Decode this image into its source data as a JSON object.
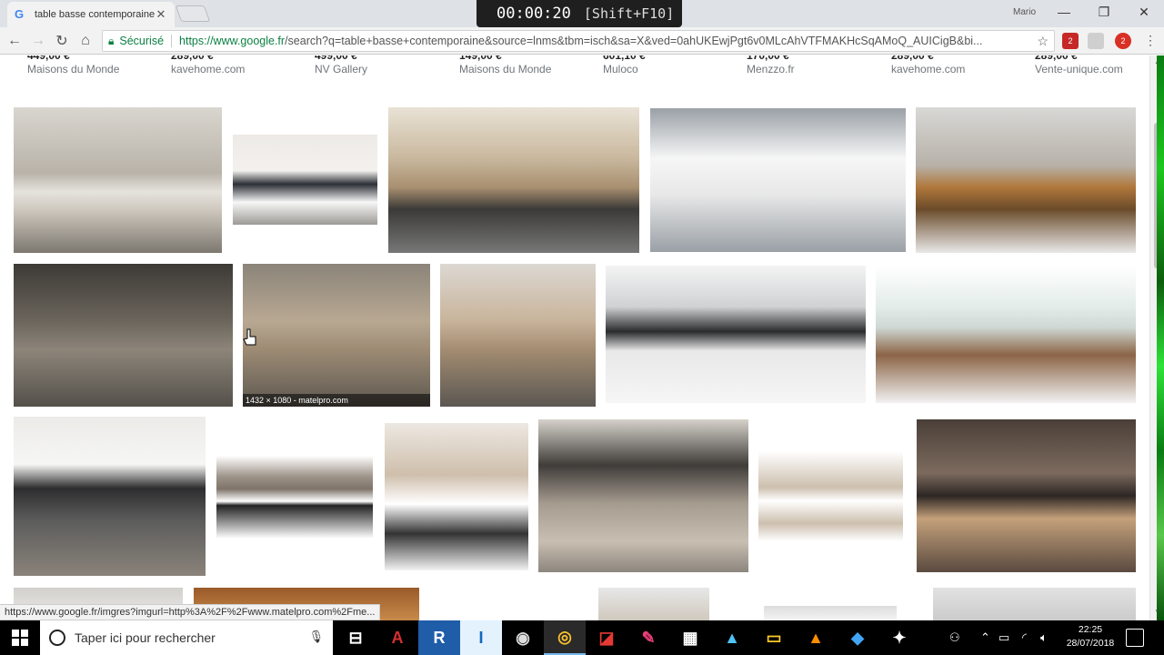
{
  "browser": {
    "tab_title": "table basse contemporaine",
    "tab_favicon": "G",
    "user_name": "Mario",
    "recorder": {
      "time": "00:00:20",
      "hotkey": "[Shift+F10]"
    },
    "security_label": "Sécurisé",
    "url_host": "https://www.google.fr",
    "url_rest": "/search?q=table+basse+contemporaine&source=lnms&tbm=isch&sa=X&ved=0ahUKEwjPgt6v0MLcAhVTFMAKHcSqAMoQ_AUICigB&bi...",
    "ext_badges": [
      "2",
      "2"
    ]
  },
  "shopping_strip": [
    {
      "price": "449,00 €",
      "store": "Maisons du Monde"
    },
    {
      "price": "289,00 €",
      "store": "kavehome.com"
    },
    {
      "price": "499,00 €",
      "store": "NV Gallery"
    },
    {
      "price": "149,00 €",
      "store": "Maisons du Monde"
    },
    {
      "price": "601,10 €",
      "store": "Muloco"
    },
    {
      "price": "170,00 €",
      "store": "Menzzo.fr"
    },
    {
      "price": "289,00 €",
      "store": "kavehome.com"
    },
    {
      "price": "289,00 €",
      "store": "Vente-unique.com"
    }
  ],
  "results": [
    {
      "id": "r1",
      "desc": "grey living room coffee table with drawers"
    },
    {
      "id": "r2",
      "desc": "black and white modern coffee table"
    },
    {
      "id": "r3",
      "desc": "wooden table with trestle legs on striped rug"
    },
    {
      "id": "r4",
      "desc": "white square lacquered coffee table"
    },
    {
      "id": "r5",
      "desc": "wood frame table with glass center"
    },
    {
      "id": "r6",
      "desc": "low rustic wooden coffee table"
    },
    {
      "id": "r7",
      "desc": "oak cube coffee table",
      "caption": "1432 × 1080 - matelpro.com"
    },
    {
      "id": "r8",
      "desc": "two-tier oak coffee table with books"
    },
    {
      "id": "r9",
      "desc": "black and white sculptural coffee table"
    },
    {
      "id": "r10",
      "desc": "curved glass coffee table with wood base"
    },
    {
      "id": "r11",
      "desc": "dark grey low table with white shelving"
    },
    {
      "id": "r12",
      "desc": "wood top metal frame coffee table"
    },
    {
      "id": "r13",
      "desc": "white and oak coffee table on striped rug"
    },
    {
      "id": "r14",
      "desc": "grey oak coffee table with grille"
    },
    {
      "id": "r15",
      "desc": "open shelf coffee table with fruit"
    },
    {
      "id": "r16",
      "desc": "stacked dark and light wood coffee table"
    }
  ],
  "status_url": "https://www.google.fr/imgres?imgurl=http%3A%2F%2Fwww.matelpro.com%2Fme...",
  "taskbar": {
    "search_placeholder": "Taper ici pour rechercher",
    "time": "22:25",
    "date": "28/07/2018"
  }
}
